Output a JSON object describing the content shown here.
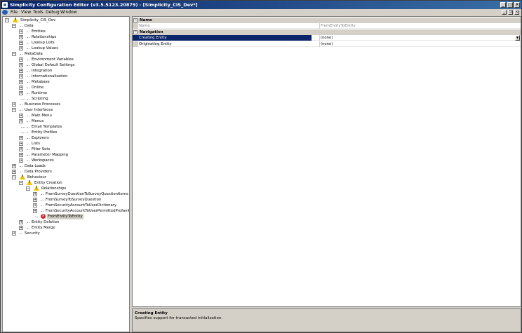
{
  "window": {
    "title": "Simplicity Configuration Editor (v3.5.5123.20879) - [Simplicity_CIS_Dev*]",
    "minimize": "_",
    "maximize": "□",
    "close": "×"
  },
  "menu": {
    "items": [
      "File",
      "View",
      "Tools",
      "Debug",
      "Window"
    ],
    "mdi_minimize": "_",
    "mdi_restore": "❐",
    "mdi_close": "×"
  },
  "tree": {
    "nodes": [
      {
        "label": "Simplicity_CIS_Dev",
        "exp": "−",
        "icon": "warn"
      },
      {
        "label": "Data",
        "exp": "−"
      },
      {
        "label": "Entities",
        "exp": "+"
      },
      {
        "label": "Relationships",
        "exp": "+"
      },
      {
        "label": "Lookup Lists",
        "exp": "+"
      },
      {
        "label": "Lookup Values",
        "exp": "+"
      },
      {
        "label": "MetaData",
        "exp": "−"
      },
      {
        "label": "Environment Variables",
        "exp": "+"
      },
      {
        "label": "Global Default Settings",
        "exp": "+"
      },
      {
        "label": "Integration",
        "exp": "+"
      },
      {
        "label": "Internationalization",
        "exp": "+"
      },
      {
        "label": "Metabase",
        "exp": "+"
      },
      {
        "label": "Online",
        "exp": "+"
      },
      {
        "label": "Runtime",
        "exp": "+"
      },
      {
        "label": "Scripting",
        "exp": ""
      },
      {
        "label": "Business Processes",
        "exp": "+"
      },
      {
        "label": "User Interfaces",
        "exp": "−"
      },
      {
        "label": "Main Menu",
        "exp": "+"
      },
      {
        "label": "Menus",
        "exp": "+"
      },
      {
        "label": "Email Templates",
        "exp": ""
      },
      {
        "label": "Entity Profiles",
        "exp": ""
      },
      {
        "label": "Explorers",
        "exp": "+"
      },
      {
        "label": "Lists",
        "exp": "+"
      },
      {
        "label": "Filter Sets",
        "exp": "+"
      },
      {
        "label": "Parameter Mapping",
        "exp": "+"
      },
      {
        "label": "Workspaces",
        "exp": "+"
      },
      {
        "label": "Data Loads",
        "exp": "+"
      },
      {
        "label": "Data Providers",
        "exp": "+"
      },
      {
        "label": "Behaviour",
        "exp": "−",
        "icon": "warn"
      },
      {
        "label": "Entity Creation",
        "exp": "−",
        "icon": "warn"
      },
      {
        "label": "Relationships",
        "exp": "−",
        "icon": "warn"
      },
      {
        "label": "FromSurveyQuestionToSurveyQuestionItems",
        "exp": "+"
      },
      {
        "label": "FromSurveyToSurveyQuestion",
        "exp": "+"
      },
      {
        "label": "FromSecurityAccountToUserDictionary",
        "exp": "+"
      },
      {
        "label": "FromSecurityAccountToUserPermittedProfanities",
        "exp": "+"
      },
      {
        "label": "FromEntityToEntity",
        "exp": "",
        "icon": "err"
      },
      {
        "label": "Entity Deletion",
        "exp": "+"
      },
      {
        "label": "Entity Merge",
        "exp": "+"
      },
      {
        "label": "Security",
        "exp": "+"
      }
    ]
  },
  "grid": {
    "cat_name": "Name",
    "cat_navigation": "Navigation",
    "name_label": "Name",
    "name_value": "FromEntityToEntity",
    "creating_label": "Creating Entity",
    "creating_value": "(none)",
    "originating_label": "Originating Entity",
    "originating_value": "(none)",
    "collapse_glyph": "−",
    "dropdown_glyph": "▼"
  },
  "description": {
    "title": "Creating Entity",
    "text": "Specifies support for transacted initialization."
  },
  "colors": {
    "titlebar": "#0a246a",
    "selection": "#0a246a",
    "warning": "#f2c200",
    "error": "#d02020"
  }
}
